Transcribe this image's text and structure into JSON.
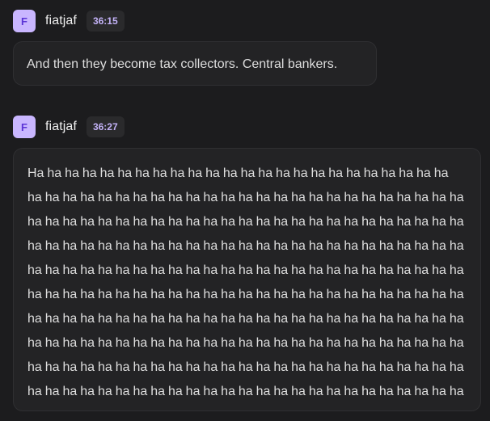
{
  "messages": [
    {
      "avatar_letter": "F",
      "author": "fiatjaf",
      "time": "36:15",
      "text": "And then they become tax collectors. Central bankers."
    },
    {
      "avatar_letter": "F",
      "author": "fiatjaf",
      "time": "36:27",
      "text": "Ha ha ha ha ha ha ha ha ha ha ha ha ha ha ha ha ha ha ha ha ha ha ha ha ha ha ha ha ha ha ha ha ha ha ha ha ha ha ha ha ha ha ha ha ha ha ha ha ha ha ha ha ha ha ha ha ha ha ha ha ha ha ha ha ha ha ha ha ha ha ha ha ha ha ha ha ha ha ha ha ha ha ha ha ha ha ha ha ha ha ha ha ha ha ha ha ha ha ha ha ha ha ha ha ha ha ha ha ha ha ha ha ha ha ha ha ha ha ha ha ha ha ha ha ha ha ha ha ha ha ha ha ha ha ha ha ha ha ha ha ha ha ha ha ha ha ha ha ha ha ha ha ha ha ha ha ha ha ha ha ha ha ha ha ha ha ha ha ha ha ha ha ha ha ha ha ha ha ha ha ha ha ha ha ha ha ha ha ha ha ha ha ha ha ha ha ha ha ha ha ha ha ha ha ha ha ha ha ha ha ha ha ha ha ha ha ha ha ha ha ha ha ha ha ha ha ha ha ha ha ha ha ha ha ha ha ha ha ha ha ha ha ha ha ha ha ha ha ha"
    }
  ]
}
